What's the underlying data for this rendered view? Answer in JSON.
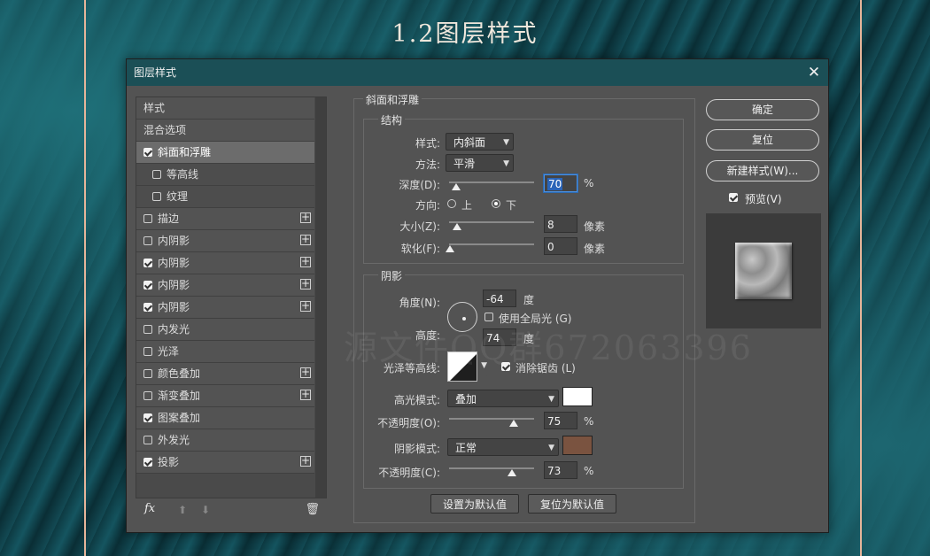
{
  "slide": {
    "title": "1.2图层样式"
  },
  "dialog": {
    "title": "图层样式",
    "close_icon": "close-icon",
    "style_list": [
      {
        "label": "样式",
        "checkbox": false,
        "checked": false,
        "plus": false,
        "active": false,
        "sub": false
      },
      {
        "label": "混合选项",
        "checkbox": false,
        "checked": false,
        "plus": false,
        "active": false,
        "sub": false
      },
      {
        "label": "斜面和浮雕",
        "checkbox": true,
        "checked": true,
        "plus": false,
        "active": true,
        "sub": false
      },
      {
        "label": "等高线",
        "checkbox": true,
        "checked": false,
        "plus": false,
        "active": false,
        "sub": true
      },
      {
        "label": "纹理",
        "checkbox": true,
        "checked": false,
        "plus": false,
        "active": false,
        "sub": true
      },
      {
        "label": "描边",
        "checkbox": true,
        "checked": false,
        "plus": true,
        "active": false,
        "sub": false
      },
      {
        "label": "内阴影",
        "checkbox": true,
        "checked": false,
        "plus": true,
        "active": false,
        "sub": false
      },
      {
        "label": "内阴影",
        "checkbox": true,
        "checked": true,
        "plus": true,
        "active": false,
        "sub": false
      },
      {
        "label": "内阴影",
        "checkbox": true,
        "checked": true,
        "plus": true,
        "active": false,
        "sub": false
      },
      {
        "label": "内阴影",
        "checkbox": true,
        "checked": true,
        "plus": true,
        "active": false,
        "sub": false
      },
      {
        "label": "内发光",
        "checkbox": true,
        "checked": false,
        "plus": false,
        "active": false,
        "sub": false
      },
      {
        "label": "光泽",
        "checkbox": true,
        "checked": false,
        "plus": false,
        "active": false,
        "sub": false
      },
      {
        "label": "颜色叠加",
        "checkbox": true,
        "checked": false,
        "plus": true,
        "active": false,
        "sub": false
      },
      {
        "label": "渐变叠加",
        "checkbox": true,
        "checked": false,
        "plus": true,
        "active": false,
        "sub": false
      },
      {
        "label": "图案叠加",
        "checkbox": true,
        "checked": true,
        "plus": false,
        "active": false,
        "sub": false
      },
      {
        "label": "外发光",
        "checkbox": true,
        "checked": false,
        "plus": false,
        "active": false,
        "sub": false
      },
      {
        "label": "投影",
        "checkbox": true,
        "checked": true,
        "plus": true,
        "active": false,
        "sub": false
      }
    ],
    "footer": {
      "fx_label": "fx",
      "up_icon": "arrow-up-icon",
      "down_icon": "arrow-down-icon",
      "trash_icon": "trash-icon"
    },
    "bevel": {
      "section_title": "斜面和浮雕",
      "structure_title": "结构",
      "style_label": "样式:",
      "style_value": "内斜面",
      "technique_label": "方法:",
      "technique_value": "平滑",
      "depth_label": "深度(D):",
      "depth_value": "70",
      "depth_unit": "%",
      "direction_label": "方向:",
      "direction_up": "上",
      "direction_down": "下",
      "direction_selected": "下",
      "size_label": "大小(Z):",
      "size_value": "8",
      "size_unit": "像素",
      "soften_label": "软化(F):",
      "soften_value": "0",
      "soften_unit": "像素"
    },
    "shading": {
      "title": "阴影",
      "angle_label": "角度(N):",
      "angle_value": "-64",
      "angle_unit": "度",
      "global_light_label": "使用全局光 (G)",
      "global_light_checked": false,
      "altitude_label": "高度:",
      "altitude_value": "74",
      "altitude_unit": "度",
      "gloss_label": "光泽等高线:",
      "antialias_label": "消除锯齿 (L)",
      "antialias_checked": true,
      "highlight_mode_label": "高光模式:",
      "highlight_mode_value": "叠加",
      "highlight_color": "#ffffff",
      "highlight_opacity_label": "不透明度(O):",
      "highlight_opacity_value": "75",
      "highlight_opacity_unit": "%",
      "shadow_mode_label": "阴影模式:",
      "shadow_mode_value": "正常",
      "shadow_color": "#7a5340",
      "shadow_opacity_label": "不透明度(C):",
      "shadow_opacity_value": "73",
      "shadow_opacity_unit": "%"
    },
    "buttons": {
      "make_default": "设置为默认值",
      "reset_default": "复位为默认值",
      "ok": "确定",
      "reset": "复位",
      "new_style": "新建样式(W)...",
      "preview_label": "预览(V)",
      "preview_checked": true
    }
  },
  "watermark": {
    "text": "源文件QQ群672063396"
  },
  "colors": {
    "titlebar": "#1b4f56",
    "dialog_bg": "#535353",
    "frame_line": "#e6b59a"
  }
}
